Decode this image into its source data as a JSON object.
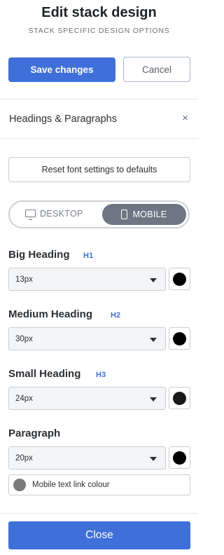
{
  "header": {
    "title": "Edit stack design",
    "subtitle": "STACK SPECIFIC DESIGN OPTIONS",
    "save_label": "Save changes",
    "cancel_label": "Cancel"
  },
  "section": {
    "title": "Headings & Paragraphs",
    "close_glyph": "×"
  },
  "reset_label": "Reset font settings to defaults",
  "device_toggle": {
    "desktop_label": "DESKTOP",
    "mobile_label": "MOBILE",
    "selected": "MOBILE"
  },
  "fonts": [
    {
      "label": "Big Heading",
      "tag": "H1",
      "value": "13px",
      "color": "#000000"
    },
    {
      "label": "Medium Heading",
      "tag": "H2",
      "value": "30px",
      "color": "#000000"
    },
    {
      "label": "Small Heading",
      "tag": "H3",
      "value": "24px",
      "color": "#1a1a1a"
    },
    {
      "label": "Paragraph",
      "tag": "",
      "value": "20px",
      "color": "#000000"
    }
  ],
  "link_colour": {
    "label": "Mobile text link colour",
    "color": "#7a7a7a"
  },
  "close_label": "Close",
  "colors": {
    "accent": "#3f6fd8",
    "toggle_active": "#6d7784"
  }
}
